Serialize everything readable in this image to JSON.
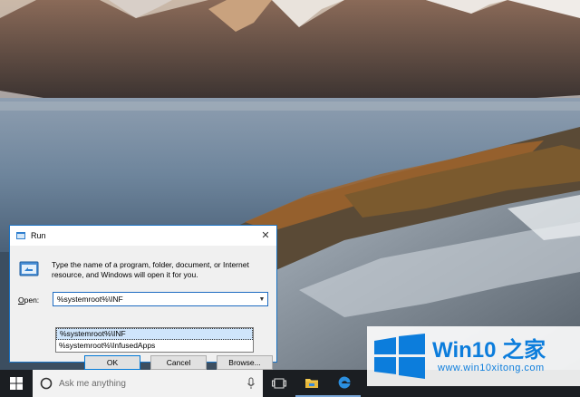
{
  "run_dialog": {
    "title": "Run",
    "close_glyph": "✕",
    "description": "Type the name of a program, folder, document, or Internet resource, and Windows will open it for you.",
    "open_label_mnemonic": "O",
    "open_label_rest": "pen:",
    "input_value": "%systemroot%\\INF",
    "autocomplete": [
      "%systemroot%\\INF",
      "%systemroot%\\InfusedApps"
    ],
    "ok_label": "OK",
    "cancel_label": "Cancel",
    "browse_label": "Browse..."
  },
  "taskbar": {
    "search_placeholder": "Ask me anything",
    "icons": [
      "windows-start-icon",
      "cortana-icon",
      "microphone-icon",
      "task-view-icon",
      "file-explorer-icon",
      "edge-icon"
    ]
  },
  "watermark": {
    "title": "Win10 之家",
    "url": "www.win10xitong.com"
  },
  "colors": {
    "accent": "#0078d7",
    "taskbar": "#1b1e22",
    "watermark_blue": "#0c7ddc"
  }
}
